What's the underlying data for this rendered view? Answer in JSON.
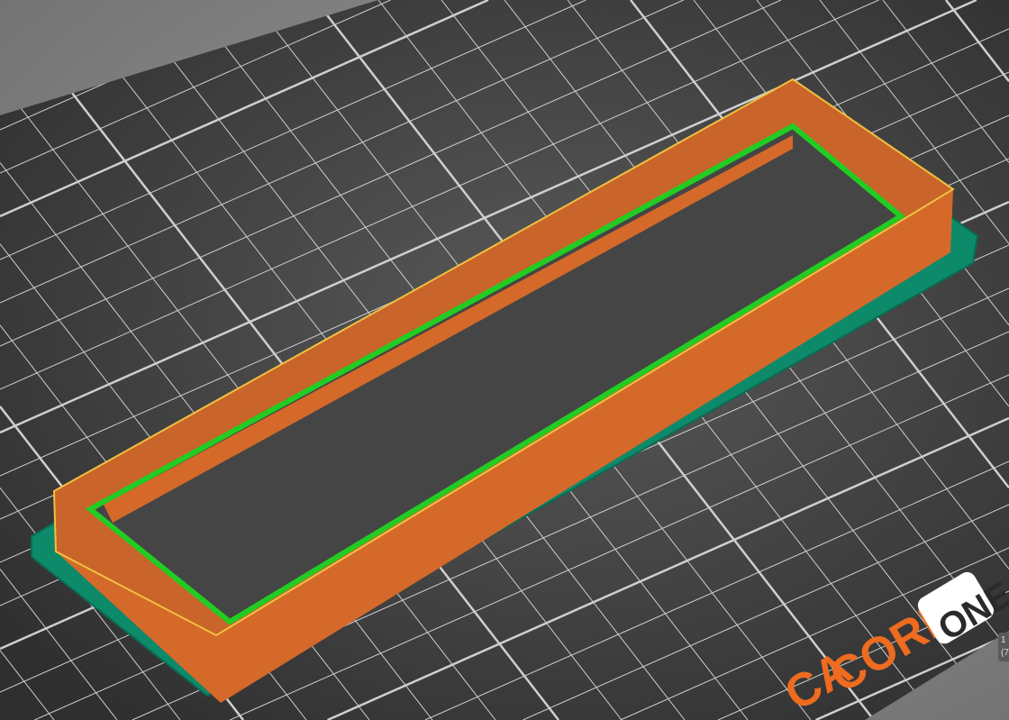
{
  "scene": {
    "bed_logo": {
      "prefix": "CA",
      "core": "CORE",
      "one": "ONE"
    },
    "tooltip": {
      "line1": "1",
      "line2": "(7"
    },
    "colors": {
      "background": "#7a7a7a",
      "bed": "#3a3a3a",
      "grid": "#cfcfcf",
      "wall": "#e0782a",
      "skirt": "#0d8a6a",
      "support": "#22cc22",
      "logo_orange": "#ee6b1f"
    }
  }
}
